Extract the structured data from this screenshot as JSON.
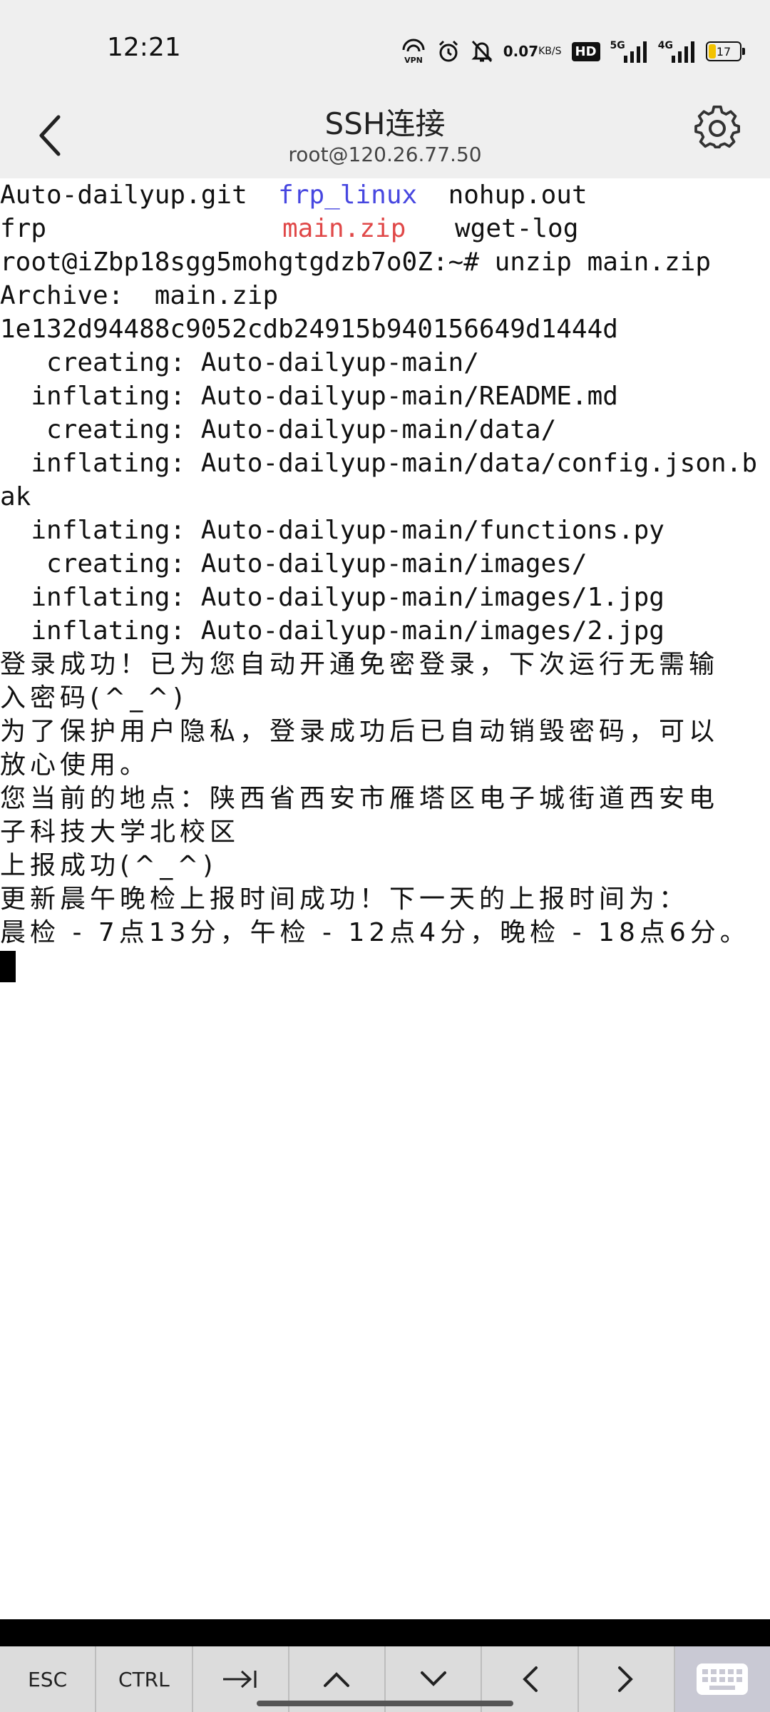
{
  "status_bar": {
    "time": "12:21",
    "net_speed": "0.07",
    "net_unit": "KB/S",
    "hd": "HD",
    "sig1": "5G",
    "sig2": "4G",
    "battery": "17",
    "icons": [
      "vpn-icon",
      "alarm-icon",
      "mute-icon",
      "hd-icon",
      "signal-5g-icon",
      "signal-4g-icon",
      "battery-icon"
    ]
  },
  "app_bar": {
    "title": "SSH连接",
    "subtitle": "root@120.26.77.50"
  },
  "terminal": {
    "ls_row1": {
      "a": "Auto-dailyup.git",
      "b": "frp_linux",
      "c": "nohup.out"
    },
    "ls_row2": {
      "a": "frp",
      "b": "main.zip",
      "c": "wget-log"
    },
    "lines": [
      "root@iZbp18sgg5mohgtgdzb7o0Z:~# unzip main.zip",
      "Archive:  main.zip",
      "1e132d94488c9052cdb24915b940156649d1444d",
      "   creating: Auto-dailyup-main/",
      "  inflating: Auto-dailyup-main/README.md",
      "   creating: Auto-dailyup-main/data/",
      "  inflating: Auto-dailyup-main/data/config.json.b",
      "ak",
      "  inflating: Auto-dailyup-main/functions.py",
      "   creating: Auto-dailyup-main/images/",
      "  inflating: Auto-dailyup-main/images/1.jpg",
      "  inflating: Auto-dailyup-main/images/2.jpg"
    ],
    "cjk_lines": [
      "登录成功！已为您自动开通免密登录，下次运行无需输",
      "入密码(^_^)",
      "为了保护用户隐私，登录成功后已自动销毁密码，可以",
      "放心使用。",
      "您当前的地点：陕西省西安市雁塔区电子城街道西安电",
      "子科技大学北校区",
      "上报成功(^_^)",
      "更新晨午晚检上报时间成功！下一天的上报时间为：",
      "晨检 - 7点13分，午检 - 12点4分，晚检 - 18点6分。"
    ]
  },
  "keys": {
    "esc": "ESC",
    "ctrl": "CTRL"
  },
  "colors": {
    "dir_blue": "#4747e0",
    "archive_red": "#e04848"
  }
}
